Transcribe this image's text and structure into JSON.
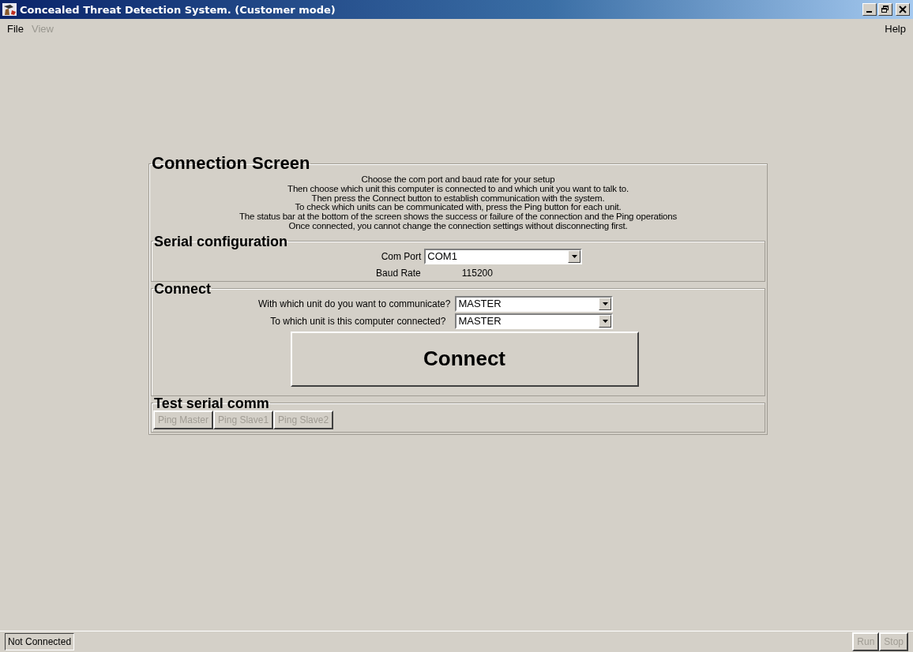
{
  "window": {
    "title": "Concealed Threat Detection System.  (Customer mode)"
  },
  "menu": {
    "items": [
      {
        "label": "File",
        "disabled": false
      },
      {
        "label": "View",
        "disabled": true
      }
    ],
    "right_items": [
      {
        "label": "Help",
        "disabled": false
      }
    ]
  },
  "panel": {
    "title": "Connection Screen",
    "instructions": [
      "Choose the com port and baud rate for your setup",
      "Then choose which unit this computer is connected to and which unit you want to talk to.",
      "Then press the Connect button to establish communication with the system.",
      "To check which units can be communicated with, press the Ping button for each unit.",
      "The status bar at the bottom of the screen shows the success or failure of the connection and the Ping operations",
      "Once connected, you cannot change the connection settings without disconnecting first."
    ],
    "serial": {
      "title": "Serial configuration",
      "com_port": {
        "label": "Com Port",
        "value": "COM1"
      },
      "baud_rate": {
        "label": "Baud Rate",
        "value": "115200"
      }
    },
    "connect": {
      "title": "Connect",
      "fields": [
        {
          "label": "With which unit do you want to communicate?",
          "value": "MASTER"
        },
        {
          "label": "To which unit is this computer connected?",
          "value": "MASTER"
        }
      ],
      "button": "Connect"
    },
    "test": {
      "title": "Test serial comm",
      "buttons": [
        {
          "label": "Ping Master",
          "disabled": true
        },
        {
          "label": "Ping Slave1",
          "disabled": true
        },
        {
          "label": "Ping Slave2",
          "disabled": true
        }
      ]
    }
  },
  "status_bar": {
    "text": "Not Connected",
    "buttons": [
      {
        "label": "Run",
        "disabled": true
      },
      {
        "label": "Stop",
        "disabled": true
      }
    ]
  }
}
